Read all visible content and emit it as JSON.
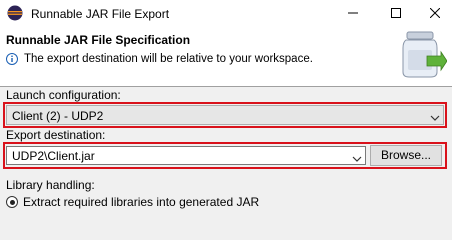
{
  "window": {
    "title": "Runnable JAR File Export",
    "icons": {
      "app": "eclipse-icon",
      "minimize": "minimize-icon",
      "maximize": "maximize-icon",
      "close": "close-icon"
    }
  },
  "header": {
    "title": "Runnable JAR File Specification",
    "message": "The export destination will be relative to your workspace.",
    "message_icon": "info-icon",
    "banner_icon": "jar-export-wizard-icon"
  },
  "launch": {
    "label": "Launch configuration:",
    "value": "Client (2) - UDP2"
  },
  "export": {
    "label": "Export destination:",
    "value": "UDP2\\Client.jar",
    "browse_label": "Browse..."
  },
  "library": {
    "label": "Library handling:",
    "option1": "Extract required libraries into generated JAR",
    "option1_selected": true
  },
  "colors": {
    "highlight": "#d9121b",
    "header_bg": "#ffffff",
    "body_bg": "#f0f0f0"
  }
}
